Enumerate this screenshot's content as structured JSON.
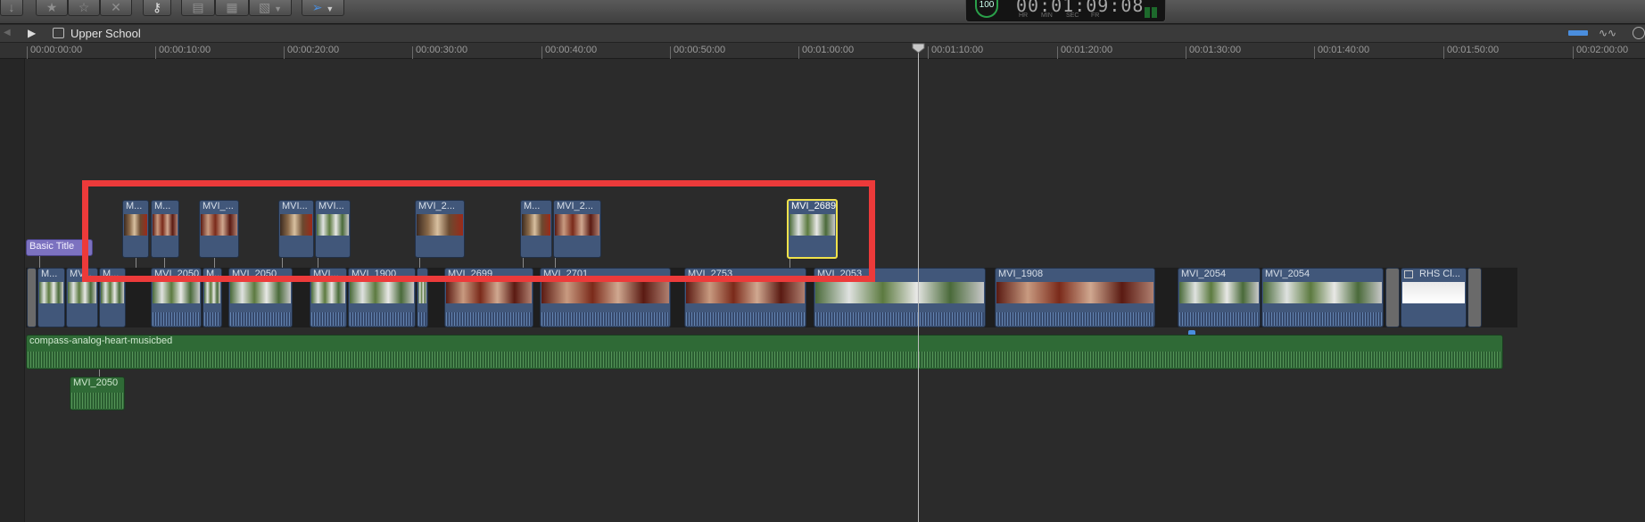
{
  "toolbar": {
    "import_icon": "download-arrow-icon",
    "favorite_icon": "star-icon",
    "unrate_icon": "star-outline-icon",
    "reject_icon": "x-icon",
    "keyword_icon": "key-icon",
    "connect_icon": "connect-clip-icon",
    "insert_icon": "insert-clip-icon",
    "append_icon": "append-clip-icon",
    "tool_icon": "arrow-pointer-icon"
  },
  "timecode": {
    "badge": "100",
    "value": "00:01:09:08",
    "units": [
      "HR",
      "MIN",
      "SEC",
      "FR"
    ]
  },
  "header": {
    "project_title": "Upper School"
  },
  "ruler": {
    "labels": [
      "00:00:00:00",
      "00:00:10:00",
      "00:00:20:00",
      "00:00:30:00",
      "00:00:40:00",
      "00:00:50:00",
      "00:01:00:00",
      "00:01:10:00",
      "00:01:20:00",
      "00:01:30:00",
      "00:01:40:00",
      "00:01:50:00",
      "00:02:00:00"
    ]
  },
  "connected_clips": [
    {
      "label": "M..."
    },
    {
      "label": "M..."
    },
    {
      "label": "MVI_..."
    },
    {
      "label": "MVI..."
    },
    {
      "label": "MVI..."
    },
    {
      "label": "MVI_2..."
    },
    {
      "label": "M..."
    },
    {
      "label": "MVI_2..."
    },
    {
      "label": "MVI_2689"
    }
  ],
  "title_clip": {
    "label": "Basic Title"
  },
  "primary_clips": [
    {
      "label": "M..."
    },
    {
      "label": "MV..."
    },
    {
      "label": "M..."
    },
    {
      "label": "MVI_2050"
    },
    {
      "label": "M..."
    },
    {
      "label": "MVI_2050"
    },
    {
      "label": "MVI..."
    },
    {
      "label": "MVI_1900"
    },
    {
      "label": "MVI_2699"
    },
    {
      "label": "MVI_2701"
    },
    {
      "label": "MVI_2753"
    },
    {
      "label": "MVI_2053"
    },
    {
      "label": "MVI_1908"
    },
    {
      "label": "MVI_2054"
    },
    {
      "label": "MVI_2054"
    },
    {
      "label": "RHS Cl..."
    }
  ],
  "music_clip": {
    "label": "compass-analog-heart-musicbed"
  },
  "audio_clip": {
    "label": "MVI_2050"
  },
  "colors": {
    "accent": "#4a8ede",
    "selection": "#f0e24a",
    "annotation": "#ec3a3a",
    "video_clip": "#41577a",
    "audio_clip": "#2f6a36",
    "title_clip": "#7c72c0"
  }
}
